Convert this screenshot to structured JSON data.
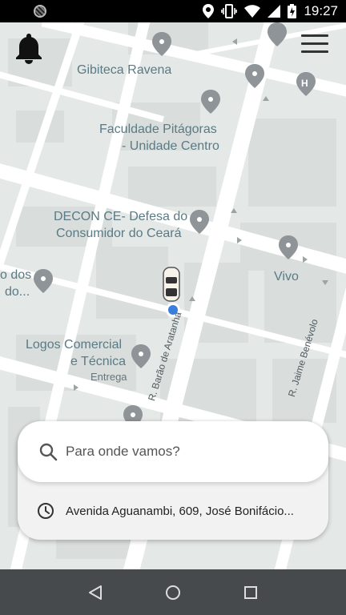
{
  "status_bar": {
    "time": "19:27",
    "icons": [
      "app-notification-icon",
      "location-icon",
      "vibrate-icon",
      "wifi-icon",
      "signal-icon",
      "battery-charging-icon"
    ]
  },
  "map": {
    "labels": {
      "gibiteca": "Gibiteca Ravena",
      "faculdade_line1": "Faculdade Pitágoras",
      "faculdade_line2": "- Unidade Centro",
      "decon_line1": "DECON CE- Defesa do",
      "decon_line2": "Consumidor do Ceará",
      "vivo": "Vivo",
      "partial_line1": "o dos",
      "partial_line2": "do...",
      "logos_line1": "Logos Comercial",
      "logos_line2": "e Técnica",
      "entrega": "Entrega",
      "street_barao": "R. Barão de Aratanha",
      "street_jaime": "R. Jaime Benévolo"
    },
    "colors": {
      "road": "#ffffff",
      "block": "#e3e7e5",
      "pin": "#8e9497",
      "location_dot": "#3b7ddd"
    }
  },
  "header": {
    "notifications_icon": "bell-icon",
    "menu_icon": "hamburger-menu-icon"
  },
  "search": {
    "placeholder": "Para onde vamos?",
    "icon": "search-icon"
  },
  "recent": {
    "address": "Avenida Aguanambi, 609, José Bonifácio...",
    "icon": "clock-icon"
  },
  "nav": {
    "back": "back-icon",
    "home": "home-icon",
    "recents": "recents-icon"
  }
}
